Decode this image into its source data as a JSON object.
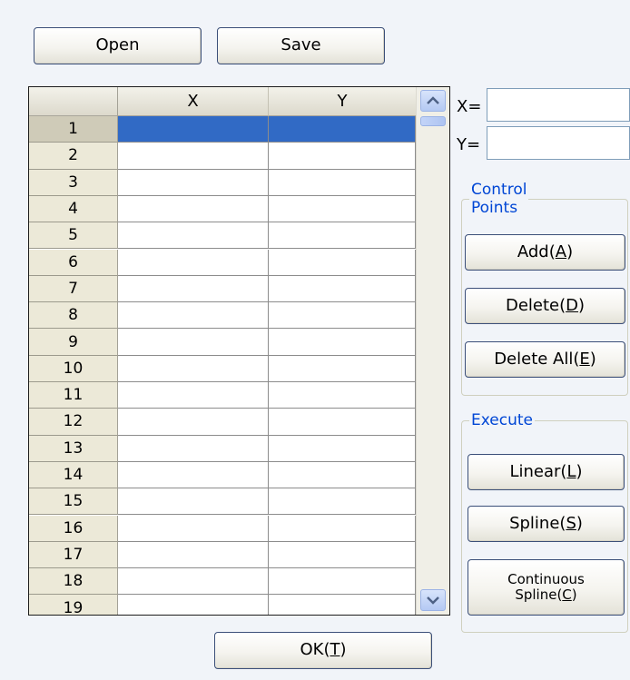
{
  "toolbar": {
    "open_label": "Open",
    "save_label": "Save"
  },
  "table": {
    "columns": [
      "X",
      "Y"
    ],
    "rows": [
      "1",
      "2",
      "3",
      "4",
      "5",
      "6",
      "7",
      "8",
      "9",
      "10",
      "11",
      "12",
      "13",
      "14",
      "15",
      "16",
      "17",
      "18",
      "19"
    ],
    "selected_row": 1,
    "selection_color": "#316ac5"
  },
  "scrollbar": {
    "up_icon": "chevron-up-icon",
    "down_icon": "chevron-down-icon"
  },
  "fields": {
    "x_label": "X=",
    "x_value": "",
    "y_label": "Y=",
    "y_value": ""
  },
  "control_points": {
    "legend_line1": "Control",
    "legend_line2": "Points",
    "add": {
      "text": "Add(",
      "key": "A",
      "end": ")"
    },
    "delete": {
      "text": "Delete(",
      "key": "D",
      "end": ")"
    },
    "delete_all": {
      "text": "Delete All(",
      "key": "E",
      "end": ")"
    }
  },
  "execute": {
    "legend": "Execute",
    "linear": {
      "text": "Linear(",
      "key": "L",
      "end": ")"
    },
    "spline": {
      "text": "Spline(",
      "key": "S",
      "end": ")"
    },
    "continuous_line1": "Continuous",
    "continuous": {
      "text": "Spline(",
      "key": "C",
      "end": ")"
    }
  },
  "ok": {
    "text": "OK(",
    "key": "T",
    "end": ")"
  },
  "colors": {
    "accent": "#0046d5",
    "background": "#f1f4f9"
  }
}
